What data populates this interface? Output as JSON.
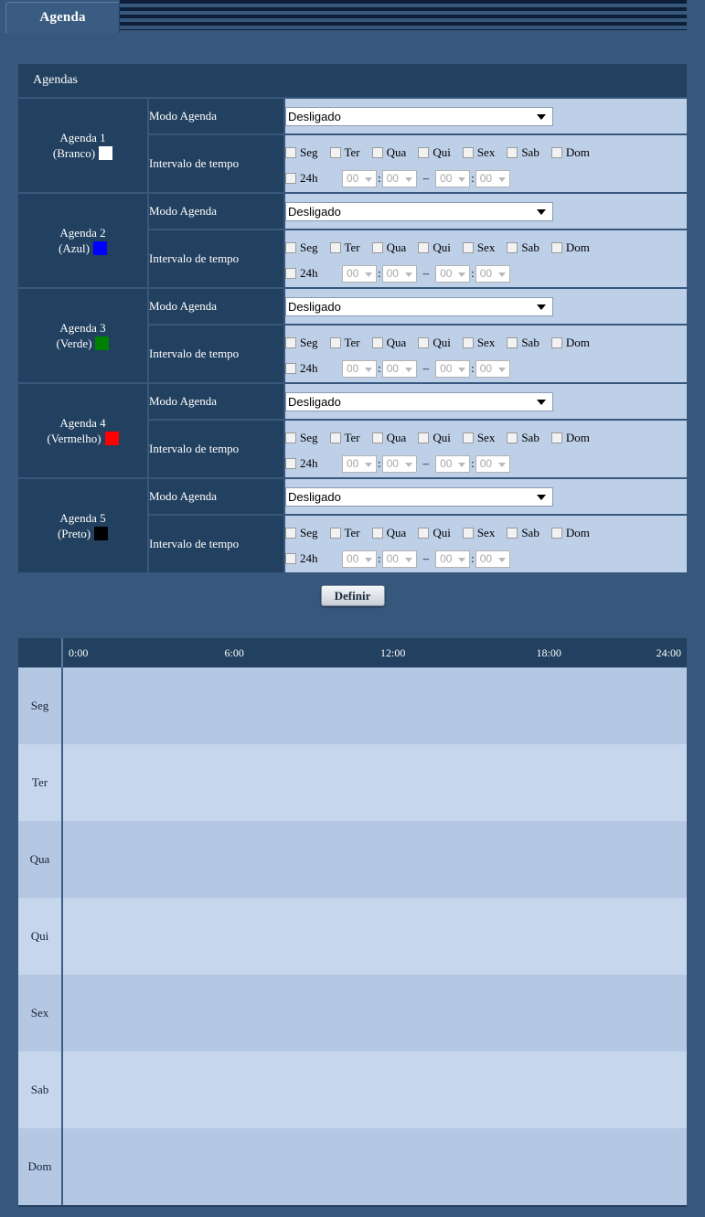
{
  "tab": {
    "label": "Agenda"
  },
  "panel": {
    "header": "Agendas",
    "labels": {
      "mode": "Modo Agenda",
      "interval": "Intervalo de tempo"
    },
    "mode_value": "Desligado",
    "mode_options": [
      "Desligado"
    ],
    "days": [
      "Seg",
      "Ter",
      "Qua",
      "Qui",
      "Sex",
      "Sab",
      "Dom"
    ],
    "all_day_label": "24h",
    "time_values": {
      "start_hour": "00",
      "start_min": "00",
      "end_hour": "00",
      "end_min": "00"
    },
    "separator": "–",
    "colon": ":",
    "rows": [
      {
        "title": "Agenda 1",
        "sub": "(Branco)",
        "color": "#ffffff"
      },
      {
        "title": "Agenda 2",
        "sub": "(Azul)",
        "color": "#0000ff"
      },
      {
        "title": "Agenda 3",
        "sub": "(Verde)",
        "color": "#008000"
      },
      {
        "title": "Agenda 4",
        "sub": "(Vermelho)",
        "color": "#ff0000"
      },
      {
        "title": "Agenda 5",
        "sub": "(Preto)",
        "color": "#000000"
      }
    ]
  },
  "submit": {
    "label": "Definir"
  },
  "chart_data": {
    "type": "table",
    "title": "",
    "xlabel": "",
    "ylabel": "",
    "ticks": [
      "0:00",
      "6:00",
      "12:00",
      "18:00",
      "24:00"
    ],
    "tick_positions": [
      0,
      25,
      50,
      75,
      100
    ],
    "categories": [
      "Seg",
      "Ter",
      "Qua",
      "Qui",
      "Sex",
      "Sab",
      "Dom"
    ],
    "series": [
      {
        "name": "Agenda 1",
        "color": "#ffffff",
        "spans": []
      },
      {
        "name": "Agenda 2",
        "color": "#0000ff",
        "spans": []
      },
      {
        "name": "Agenda 3",
        "color": "#008000",
        "spans": []
      },
      {
        "name": "Agenda 4",
        "color": "#ff0000",
        "spans": []
      },
      {
        "name": "Agenda 5",
        "color": "#000000",
        "spans": []
      }
    ],
    "xlim": [
      0,
      24
    ],
    "grid": false,
    "legend": "none"
  }
}
